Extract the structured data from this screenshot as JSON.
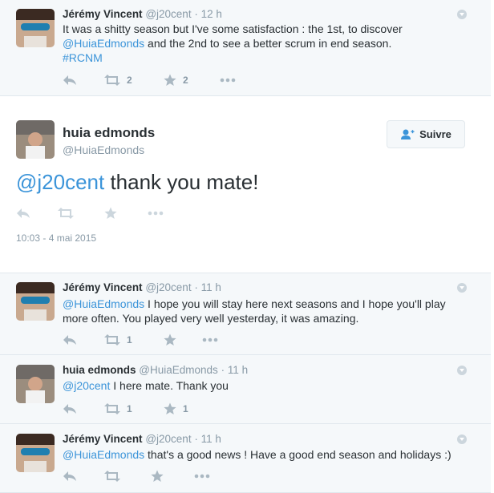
{
  "tweets": [
    {
      "fullname": "Jérémy Vincent",
      "screen_name": "@j20cent",
      "dot": "·",
      "time": "12 h",
      "line1": "It was a shitty season but I've some satisfaction : the 1st, to discover",
      "line2_link": "@HuiaEdmonds",
      "line2_rest": " and the 2nd to see a better scrum in end season.",
      "hashtag": "#RCNM",
      "retweets": "2",
      "favorites": "2"
    },
    {
      "fullname": "Jérémy Vincent",
      "screen_name": "@j20cent",
      "dot": "·",
      "time": "11 h",
      "mention": "@HuiaEdmonds",
      "line1_rest": " I hope you will stay here next seasons and I hope you'll play",
      "line2": "more often. You played very well yesterday, it was amazing.",
      "retweets": "1"
    },
    {
      "fullname": "huia edmonds",
      "screen_name": "@HuiaEdmonds",
      "dot": "·",
      "time": "11 h",
      "mention": "@j20cent",
      "text_rest": " I here mate. Thank you",
      "retweets": "1",
      "favorites": "1"
    },
    {
      "fullname": "Jérémy Vincent",
      "screen_name": "@j20cent",
      "dot": "·",
      "time": "11 h",
      "mention": "@HuiaEdmonds",
      "text_rest": " that's a good news ! Have a good end season and holidays :)"
    }
  ],
  "focused_tweet": {
    "fullname": "huia edmonds",
    "screen_name": "@HuiaEdmonds",
    "follow_label": "Suivre",
    "mention": "@j20cent",
    "text_rest": " thank you mate!",
    "timestamp": "10:03 - 4 mai 2015"
  },
  "colors": {
    "link": "#3b94d9",
    "reply_bg": "#f5f8fa",
    "icon": "#aab8c2"
  }
}
